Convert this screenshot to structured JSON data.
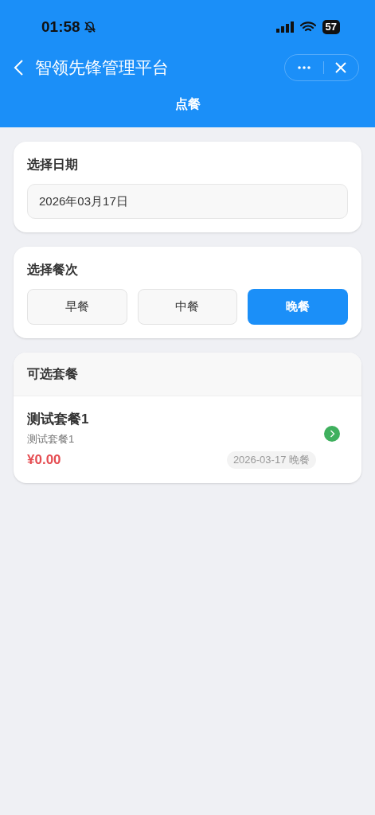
{
  "status_bar": {
    "time": "01:58",
    "battery": "57"
  },
  "nav": {
    "title": "智领先锋管理平台",
    "subtitle": "点餐"
  },
  "date_card": {
    "title": "选择日期",
    "value": "2026年03月17日"
  },
  "meal_card": {
    "title": "选择餐次",
    "options": [
      {
        "label": "早餐",
        "selected": false
      },
      {
        "label": "中餐",
        "selected": false
      },
      {
        "label": "晚餐",
        "selected": true
      }
    ]
  },
  "packages": {
    "title": "可选套餐",
    "items": [
      {
        "name": "测试套餐1",
        "description": "测试套餐1",
        "price": "¥0.00",
        "tag": "2026-03-17 晚餐"
      }
    ]
  }
}
